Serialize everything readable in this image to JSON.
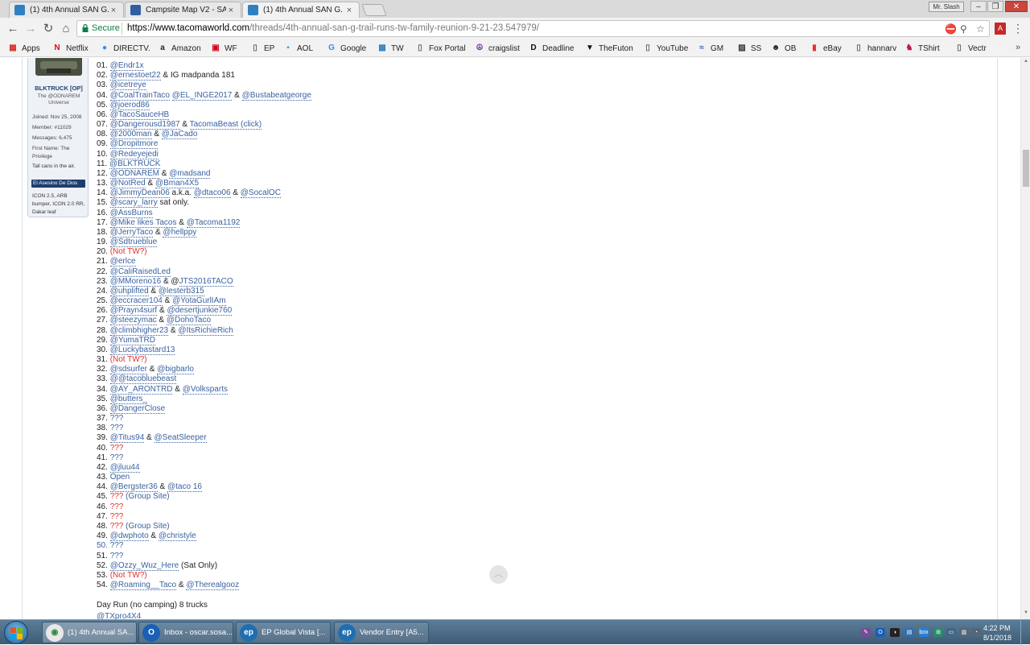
{
  "browser": {
    "tabs": [
      {
        "title": "(1) 4th Annual SAN G. TR",
        "favicon_color": "#2f7fc1",
        "active": false
      },
      {
        "title": "Campsite Map V2 - SAN",
        "favicon_color": "#2f5fa0",
        "active": false
      },
      {
        "title": "(1) 4th Annual SAN G. TR",
        "favicon_color": "#2f7fc1",
        "active": true
      }
    ],
    "tab_close": "×",
    "profile": "Mr. Slash",
    "window_controls": {
      "minimize": "–",
      "restore": "❐",
      "close": "✕"
    },
    "nav": {
      "back": "←",
      "forward": "→",
      "reload": "↻",
      "home": "⌂"
    },
    "omnibox": {
      "secure_label": "Secure",
      "url_host": "https://www.tacomaworld.com",
      "url_path": "/threads/4th-annual-san-g-trail-runs-tw-family-reunion-9-21-23.547979/"
    },
    "omnibox_icons": {
      "extension": "⛔",
      "zoom": "⚲",
      "star": "☆"
    },
    "pdf_icon": "A",
    "menu_icon": "⋮",
    "bookmarks_more": "»",
    "bookmarks": [
      {
        "label": "Apps",
        "icon": "▦",
        "color": "#d93025"
      },
      {
        "label": "Netflix",
        "icon": "N",
        "color": "#e50914"
      },
      {
        "label": "DIRECTV.",
        "icon": "●",
        "color": "#1e90ff"
      },
      {
        "label": "Amazon",
        "icon": "a",
        "color": "#222222"
      },
      {
        "label": "WF",
        "icon": "▣",
        "color": "#d4001a"
      },
      {
        "label": "EP",
        "icon": "▯",
        "color": "#666666"
      },
      {
        "label": "AOL",
        "icon": "▪",
        "color": "#31a4e3"
      },
      {
        "label": "Google",
        "icon": "G",
        "color": "#4285f4"
      },
      {
        "label": "TW",
        "icon": "▩",
        "color": "#2f7fc1"
      },
      {
        "label": "Fox Portal",
        "icon": "▯",
        "color": "#666666"
      },
      {
        "label": "craigslist",
        "icon": "☮",
        "color": "#7a3a9a"
      },
      {
        "label": "Deadline",
        "icon": "D",
        "color": "#111111"
      },
      {
        "label": "TheFuton",
        "icon": "▼",
        "color": "#111111"
      },
      {
        "label": "YouTube",
        "icon": "▯",
        "color": "#666666"
      },
      {
        "label": "GM",
        "icon": "≈",
        "color": "#2a5aa8"
      },
      {
        "label": "SS",
        "icon": "▨",
        "color": "#333333"
      },
      {
        "label": "OB",
        "icon": "☻",
        "color": "#222222"
      },
      {
        "label": "eBay",
        "icon": "▮",
        "color": "#e53238"
      },
      {
        "label": "hannarv",
        "icon": "▯",
        "color": "#666666"
      },
      {
        "label": "TShirt",
        "icon": "♞",
        "color": "#c2185b"
      },
      {
        "label": "Vectr",
        "icon": "▯",
        "color": "#666666"
      }
    ]
  },
  "user_card": {
    "username": "BLKTRUCK [OP]",
    "title": "The @ODNAREM Universe",
    "stats": [
      "Joined: Nov 25, 2008",
      "Member: #11029",
      "Messages: 6,475",
      "First Name: The",
      "Privilege"
    ],
    "note": "Tall cans in the air.",
    "banner": "El Asesino De Dios",
    "rig": "ICON 2.5, ARB bumper, ICON 2.0 RR, Dakar leaf"
  },
  "roster": [
    {
      "num": "01.",
      "parts": [
        {
          "u": "@Endr1x"
        }
      ]
    },
    {
      "num": "02.",
      "parts": [
        {
          "u": "@ernestoet22"
        },
        {
          "t": " & IG madpanda 181"
        }
      ]
    },
    {
      "num": "03.",
      "parts": [
        {
          "u": "@icetreye"
        }
      ]
    },
    {
      "num": "04.",
      "parts": [
        {
          "u": "@CoalTrainTaco"
        },
        {
          "t": " "
        },
        {
          "u": "@EL_INGE2017"
        },
        {
          "t": " & "
        },
        {
          "u": "@Bustabeatgeorge"
        }
      ]
    },
    {
      "num": "05.",
      "parts": [
        {
          "u": "@joerod86"
        }
      ]
    },
    {
      "num": "06.",
      "parts": [
        {
          "u": "@TacoSauceHB"
        }
      ]
    },
    {
      "num": "07.",
      "parts": [
        {
          "u": "@Dangerousd1987"
        },
        {
          "t": " & "
        },
        {
          "u": "TacomaBeast (click)"
        }
      ]
    },
    {
      "num": "08.",
      "parts": [
        {
          "u": "@2000man"
        },
        {
          "t": " & "
        },
        {
          "u": "@JaCado"
        }
      ]
    },
    {
      "num": "09.",
      "parts": [
        {
          "u": "@Dropitmore"
        }
      ]
    },
    {
      "num": "10.",
      "parts": [
        {
          "u": "@Redeyejedi"
        }
      ]
    },
    {
      "num": "11.",
      "parts": [
        {
          "u": "@BLKTRUCK"
        }
      ]
    },
    {
      "num": "12.",
      "parts": [
        {
          "u": "@ODNAREM"
        },
        {
          "t": " & "
        },
        {
          "u": "@madsand"
        }
      ]
    },
    {
      "num": "13.",
      "parts": [
        {
          "u": "@NotRed"
        },
        {
          "t": " & "
        },
        {
          "u": "@Bman4X5"
        }
      ]
    },
    {
      "num": "14.",
      "parts": [
        {
          "u": "@JimmyDean06"
        },
        {
          "t": " a.k.a. "
        },
        {
          "u": "@dtaco06"
        },
        {
          "t": " & "
        },
        {
          "u": "@SocalOC"
        }
      ]
    },
    {
      "num": "15.",
      "parts": [
        {
          "u": "@scary_larry"
        },
        {
          "t": " sat only."
        }
      ]
    },
    {
      "num": "16.",
      "parts": [
        {
          "u": "@AssBurns"
        }
      ]
    },
    {
      "num": "17.",
      "parts": [
        {
          "u": "@Mike likes Tacos"
        },
        {
          "t": " & "
        },
        {
          "u": "@Tacoma1192"
        }
      ]
    },
    {
      "num": "18.",
      "parts": [
        {
          "u": "@JerryTaco"
        },
        {
          "t": " & "
        },
        {
          "u": "@hellppy"
        }
      ]
    },
    {
      "num": "19.",
      "parts": [
        {
          "u": "@Sdtrueblue"
        }
      ]
    },
    {
      "num": "20.",
      "parts": [
        {
          "r": "(Not TW?)"
        }
      ]
    },
    {
      "num": "21.",
      "parts": [
        {
          "u": "@erlce"
        }
      ]
    },
    {
      "num": "22.",
      "parts": [
        {
          "u": "@CaliRaisedLed"
        }
      ]
    },
    {
      "num": "23.",
      "parts": [
        {
          "u": "@MMoreno16"
        },
        {
          "t": " & @"
        },
        {
          "u": "JTS2016TACO"
        }
      ]
    },
    {
      "num": "24.",
      "parts": [
        {
          "u": "@uhplifted"
        },
        {
          "t": " & "
        },
        {
          "u": "@lesterb315"
        }
      ]
    },
    {
      "num": "25.",
      "parts": [
        {
          "u": "@eccracer104"
        },
        {
          "t": " & "
        },
        {
          "u": "@YotaGurlIAm"
        }
      ]
    },
    {
      "num": "26.",
      "parts": [
        {
          "u": "@Prayn4surf"
        },
        {
          "t": " & "
        },
        {
          "u": "@desertjunkie760"
        }
      ]
    },
    {
      "num": "27.",
      "parts": [
        {
          "u": "@steezymac"
        },
        {
          "t": " & "
        },
        {
          "u": "@DohoTaco"
        }
      ]
    },
    {
      "num": "28.",
      "parts": [
        {
          "u": "@climbhigher23"
        },
        {
          "t": " & "
        },
        {
          "u": "@ItsRichieRich"
        }
      ]
    },
    {
      "num": "29.",
      "parts": [
        {
          "u": "@YumaTRD"
        }
      ]
    },
    {
      "num": "30.",
      "parts": [
        {
          "u": "@Luckybastard13"
        }
      ]
    },
    {
      "num": "31.",
      "parts": [
        {
          "r": "(Not TW?)"
        }
      ]
    },
    {
      "num": "32.",
      "parts": [
        {
          "u": "@sdsurfer"
        },
        {
          "t": " & "
        },
        {
          "u": "@bigbarlo"
        }
      ]
    },
    {
      "num": "33.",
      "parts": [
        {
          "u": "@@tacobluebeast"
        }
      ]
    },
    {
      "num": "34.",
      "parts": [
        {
          "u": "@AY_ARONTRD"
        },
        {
          "t": " & "
        },
        {
          "u": "@Volksparts"
        }
      ]
    },
    {
      "num": "35.",
      "parts": [
        {
          "u": "@butters_"
        }
      ]
    },
    {
      "num": "36.",
      "parts": [
        {
          "u": "@DangerClose"
        }
      ]
    },
    {
      "num": "37.",
      "parts": [
        {
          "b": "???"
        }
      ]
    },
    {
      "num": "38.",
      "parts": [
        {
          "b": "???"
        }
      ]
    },
    {
      "num": "39.",
      "parts": [
        {
          "u": "@Titus94"
        },
        {
          "t": " & "
        },
        {
          "u": "@SeatSleeper"
        }
      ]
    },
    {
      "num": "40.",
      "parts": [
        {
          "r": "???"
        }
      ]
    },
    {
      "num": "41.",
      "parts": [
        {
          "b": "???"
        }
      ]
    },
    {
      "num": "42.",
      "parts": [
        {
          "u": "@jluu44"
        }
      ]
    },
    {
      "num": "43.",
      "parts": [
        {
          "b": "Open"
        }
      ]
    },
    {
      "num": "44.",
      "parts": [
        {
          "u": "@Bergster36"
        },
        {
          "t": " & "
        },
        {
          "u": "@taco 16"
        }
      ]
    },
    {
      "num": "45.",
      "parts": [
        {
          "r": "???"
        },
        {
          "b": " (Group Site)"
        }
      ]
    },
    {
      "num": "46.",
      "parts": [
        {
          "r": "???"
        }
      ]
    },
    {
      "num": "47.",
      "parts": [
        {
          "r": "???"
        }
      ]
    },
    {
      "num": "48.",
      "parts": [
        {
          "r": "???"
        },
        {
          "b": " (Group Site)"
        }
      ]
    },
    {
      "num": "49.",
      "parts": [
        {
          "u": "@dwphoto"
        },
        {
          "t": " & "
        },
        {
          "u": "@christyle"
        }
      ]
    },
    {
      "num": "50.",
      "num_color": "blue",
      "parts": [
        {
          "b": "???"
        }
      ]
    },
    {
      "num": "51.",
      "parts": [
        {
          "b": "???"
        }
      ]
    },
    {
      "num": "52.",
      "parts": [
        {
          "u": "@Ozzy_Wuz_Here"
        },
        {
          "t": " (Sat Only)"
        }
      ]
    },
    {
      "num": "53.",
      "parts": [
        {
          "r": "(Not TW?)"
        }
      ]
    },
    {
      "num": "54.",
      "parts": [
        {
          "u": "@Roaming__Taco"
        },
        {
          "t": " & "
        },
        {
          "u": "@Therealgooz"
        }
      ]
    }
  ],
  "day_run": {
    "heading": "Day Run (no camping) 8 trucks",
    "first": "@TXpro4X4"
  },
  "scroll_top_icon": "︿",
  "scrollbar": {
    "up": "▲",
    "down": "▼"
  },
  "taskbar": {
    "tasks": [
      {
        "label": "(1) 4th Annual SA...",
        "icon": "◉",
        "icon_bg": "#e8e8e8",
        "icon_fg": "#2a8a3a",
        "active": true
      },
      {
        "label": "Inbox - oscar.sosa...",
        "icon": "O",
        "icon_bg": "#1a5fb4",
        "icon_fg": "#ffffff",
        "active": false
      },
      {
        "label": "EP Global Vista  [...",
        "icon": "ep",
        "icon_bg": "#1f6fb0",
        "icon_fg": "#ffffff",
        "active": false
      },
      {
        "label": "Vendor Entry  [A5...",
        "icon": "ep",
        "icon_bg": "#1f6fb0",
        "icon_fg": "#ffffff",
        "active": false
      }
    ],
    "tray": [
      {
        "icon": "✎",
        "color": "#7a4a9a"
      },
      {
        "icon": "O",
        "color": "#1a5fb4"
      },
      {
        "icon": "◑",
        "color": "#222222"
      },
      {
        "icon": "▤",
        "color": "#2f6fb0"
      },
      {
        "icon": "box",
        "color": "#2a7fd4"
      },
      {
        "icon": "⊞",
        "color": "#2a8a6a"
      },
      {
        "icon": "▭",
        "color": "#446688"
      },
      {
        "icon": "▥",
        "color": "#556677"
      },
      {
        "icon": "◔",
        "color": "#556677"
      }
    ],
    "time": "4:22 PM",
    "date": "8/1/2018"
  }
}
